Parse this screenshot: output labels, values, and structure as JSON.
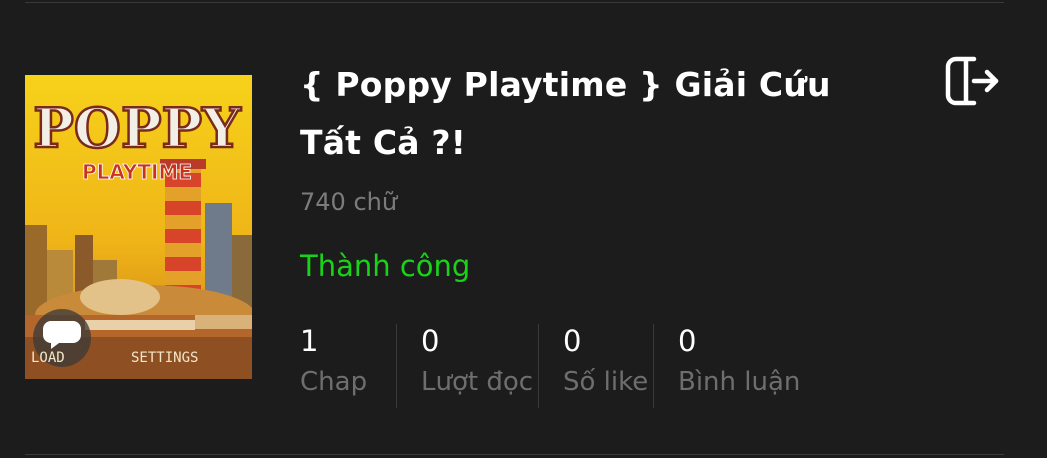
{
  "story": {
    "cover_title": "POPPY",
    "cover_subtitle": "PLAYTIME",
    "cover_menu_left": "LOAD",
    "cover_menu_right": "SETTINGS",
    "title": "{ Poppy Playtime } Giải Cứu Tất Cả ?!",
    "word_count": "740 chữ",
    "status": "Thành công",
    "status_color": "#19d319"
  },
  "stats": [
    {
      "value": "1",
      "label": "Chap"
    },
    {
      "value": "0",
      "label": "Lượt đọc"
    },
    {
      "value": "0",
      "label": "Số like"
    },
    {
      "value": "0",
      "label": "Bình luận"
    }
  ],
  "icons": {
    "exit": "logout-icon",
    "chat": "chat-bubble-icon"
  }
}
